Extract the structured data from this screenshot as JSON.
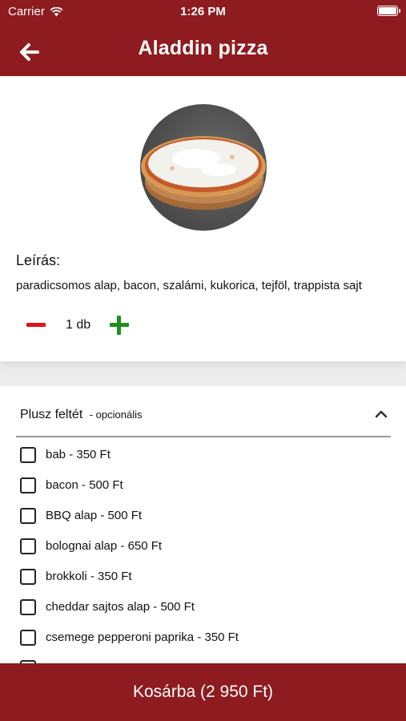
{
  "status_bar": {
    "carrier": "Carrier",
    "time": "1:26 PM"
  },
  "header": {
    "title": "Aladdin pizza",
    "back_icon": "arrow-left-icon"
  },
  "product": {
    "description_label": "Leírás:",
    "description": "paradicsomos alap, bacon, szalámi, kukorica, tejföl, trappista sajt",
    "quantity": "1 db"
  },
  "extras": {
    "title": "Plusz feltét",
    "subtitle": "- opcionális",
    "items": [
      {
        "label": "bab - 350 Ft",
        "checked": false
      },
      {
        "label": "bacon - 500 Ft",
        "checked": false
      },
      {
        "label": "BBQ alap - 500 Ft",
        "checked": false
      },
      {
        "label": "bolognai alap - 650 Ft",
        "checked": false
      },
      {
        "label": "brokkoli - 350 Ft",
        "checked": false
      },
      {
        "label": "cheddar sajtos alap - 500 Ft",
        "checked": false
      },
      {
        "label": "csemege pepperoni paprika - 350 Ft",
        "checked": false
      }
    ]
  },
  "cart_button": {
    "label": "Kosárba (2 950 Ft)"
  },
  "colors": {
    "brand": "#8e1b1f",
    "minus": "#e0121b",
    "plus": "#1d8f1d"
  }
}
